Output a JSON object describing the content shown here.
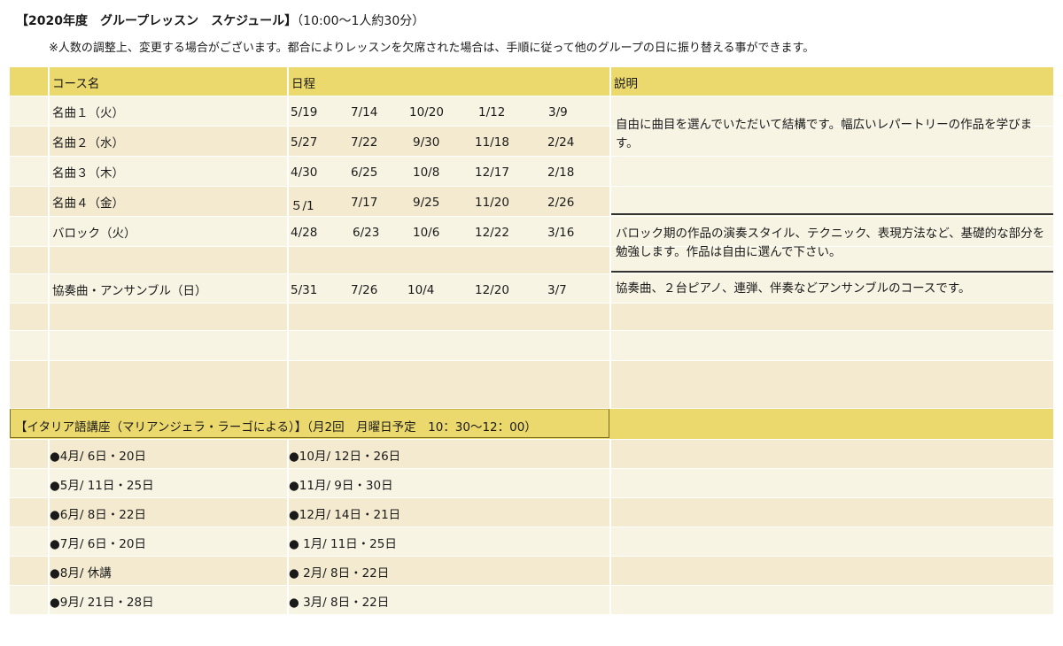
{
  "header": {
    "title_bold": "【2020年度　グループレッスン　スケジュール】",
    "title_rest": "（10:00〜1人約30分）",
    "note": "※人数の調整上、変更する場合がございます。都合によりレッスンを欠席された場合は、手順に従って他のグループの日に振り替える事ができます。"
  },
  "table": {
    "col_course": "コース名",
    "col_schedule": "日程",
    "col_description": "説明",
    "courses": [
      {
        "name": "名曲１（火）",
        "dates": [
          "5/19",
          "7/14",
          "10/20",
          "1/12",
          "3/9"
        ]
      },
      {
        "name": "名曲２（水）",
        "dates": [
          "5/27",
          "7/22",
          "9/30",
          "11/18",
          "2/24"
        ]
      },
      {
        "name": "名曲３（木）",
        "dates": [
          "4/30",
          "6/25",
          "10/8",
          "12/17",
          "2/18"
        ]
      },
      {
        "name": "名曲４（金）",
        "dates": [
          "５/1",
          "7/17",
          "9/25",
          "11/20",
          "2/26"
        ]
      },
      {
        "name": "バロック（火）",
        "dates": [
          "4/28",
          "6/23",
          "10/6",
          "12/22",
          "3/16"
        ]
      },
      {
        "name": "",
        "dates": [
          "",
          "",
          "",
          "",
          ""
        ]
      },
      {
        "name": "協奏曲・アンサンブル（日）",
        "dates": [
          "5/31",
          "7/26",
          "10/4",
          "12/20",
          "3/7"
        ]
      }
    ],
    "descriptions": [
      "自由に曲目を選んでいただいて結構です。幅広いレパートリーの作品を学びます。",
      "バロック期の作品の演奏スタイル、テクニック、表現方法など、基礎的な部分を勉強します。作品は自由に選んで下さい。",
      "協奏曲、２台ピアノ、連弾、伴奏などアンサンブルのコースです。"
    ]
  },
  "italian": {
    "title": "【イタリア語講座（マリアンジェラ・ラーゴによる）】（月2回　月曜日予定　10：30〜12：00）",
    "left": [
      "●4月/   6日・20日",
      "●5月/  11日・25日",
      "●6月/   8日・22日",
      "●7月/   6日・20日",
      "●8月/ 休講",
      "●9月/  21日・28日"
    ],
    "right": [
      "●10月/ 12日・26日",
      "●11月/   9日・30日",
      "●12月/ 14日・21日",
      "● 1月/   11日・25日",
      "● 2月/     8日・22日",
      "● 3月/     8日・22日"
    ]
  }
}
